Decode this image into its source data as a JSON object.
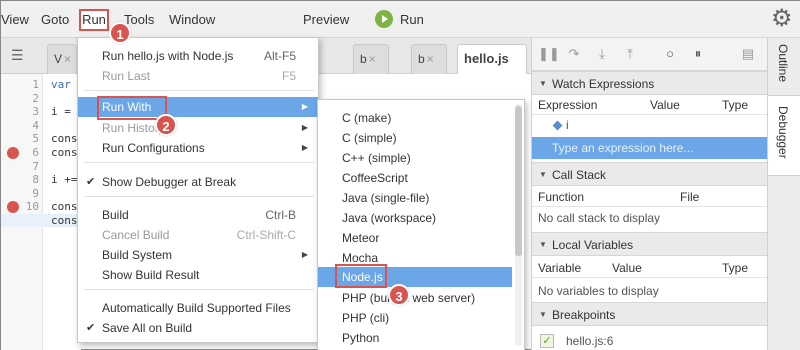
{
  "menubar": {
    "items": [
      "View",
      "Goto",
      "Run",
      "Tools",
      "Window"
    ],
    "preview": "Preview",
    "run": "Run"
  },
  "badges": [
    "1",
    "2",
    "3"
  ],
  "tabs": [
    "V",
    "b",
    "b",
    "b",
    "hello.js"
  ],
  "editor": {
    "line_numbers": [
      "1",
      "2",
      "3",
      "4",
      "5",
      "6",
      "7",
      "8",
      "9",
      "10",
      "11"
    ],
    "lines": [
      "var",
      "",
      "i =",
      "",
      "cons",
      "cons",
      "",
      "i +=",
      "",
      "cons",
      "cons"
    ],
    "breakpoint_lines": [
      6,
      10
    ],
    "current_line": 11
  },
  "run_menu": {
    "items": [
      {
        "label": "Run hello.js with Node.js",
        "shortcut": "Alt-F5",
        "disabled": false
      },
      {
        "label": "Run Last",
        "shortcut": "F5",
        "disabled": true
      },
      {
        "label": "Run With",
        "submenu": true,
        "highlighted": true
      },
      {
        "label": "Run History",
        "submenu": true,
        "disabled": true
      },
      {
        "label": "Run Configurations",
        "submenu": true
      },
      {
        "label": "Show Debugger at Break",
        "checked": true
      },
      {
        "label": "Build",
        "shortcut": "Ctrl-B"
      },
      {
        "label": "Cancel Build",
        "shortcut": "Ctrl-Shift-C",
        "disabled": true
      },
      {
        "label": "Build System",
        "submenu": true
      },
      {
        "label": "Show Build Result"
      },
      {
        "label": "Automatically Build Supported Files"
      },
      {
        "label": "Save All on Build",
        "checked": true
      }
    ]
  },
  "run_with_menu": {
    "items": [
      "C (make)",
      "C (simple)",
      "C++ (simple)",
      "CoffeeScript",
      "Java (single-file)",
      "Java (workspace)",
      "Meteor",
      "Mocha",
      "Node.js",
      "PHP (built-in web server)",
      "PHP (cli)",
      "Python"
    ],
    "highlighted": "Node.js"
  },
  "debugger": {
    "watch": {
      "title": "Watch Expressions",
      "columns": [
        "Expression",
        "Value",
        "Type"
      ],
      "rows": [
        "i"
      ],
      "placeholder": "Type an expression here..."
    },
    "callstack": {
      "title": "Call Stack",
      "columns": [
        "Function",
        "File"
      ],
      "empty": "No call stack to display"
    },
    "locals": {
      "title": "Local Variables",
      "columns": [
        "Variable",
        "Value",
        "Type"
      ],
      "empty": "No variables to display"
    },
    "breakpoints": {
      "title": "Breakpoints",
      "items": [
        "hello.js:6"
      ]
    }
  },
  "side_tabs": [
    "Outline",
    "Debugger"
  ],
  "colors": {
    "highlight": "#6aa6e8",
    "annotation_red": "#d9534f",
    "run_green": "#7cb342"
  }
}
